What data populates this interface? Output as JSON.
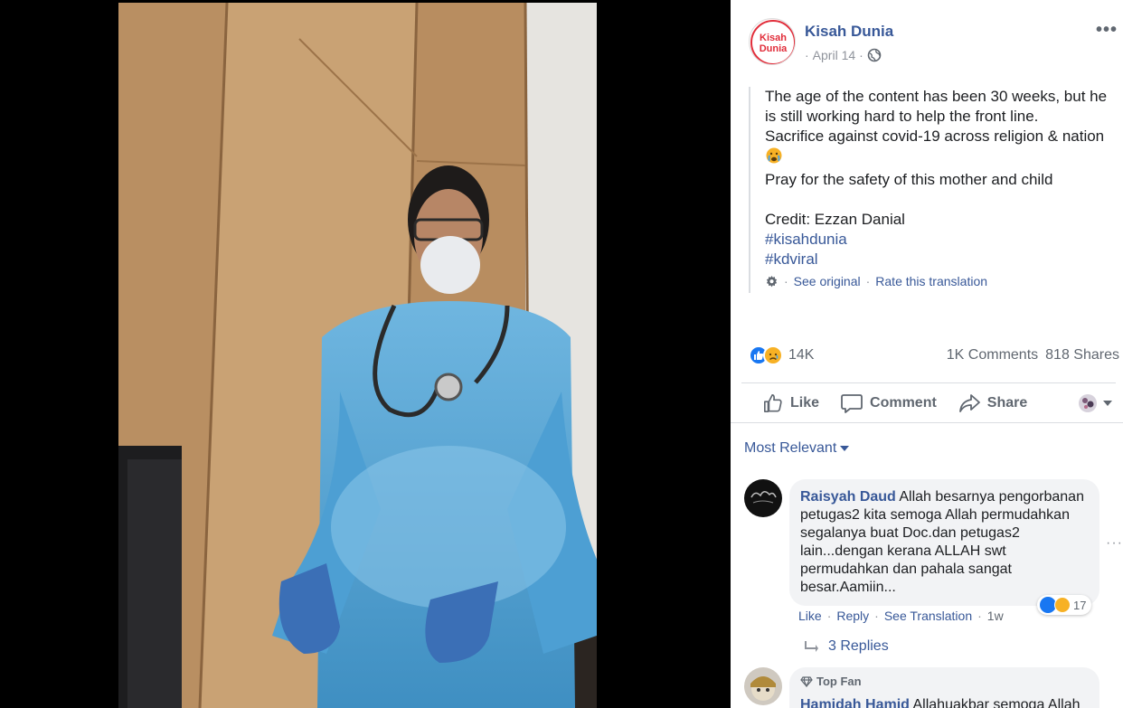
{
  "post": {
    "page_name": "Kisah Dunia",
    "logo_text_1": "Kisah",
    "logo_text_2": "Dunia",
    "date": "April 14",
    "date_separator": "·",
    "more_options": "•••",
    "text_lines": [
      "The age of the content has been 30 weeks, but he",
      "is still working hard to help the front line.",
      "Sacrifice against covid-19 across religion & nation",
      "Pray for the safety of this mother and child",
      "Credit: Ezzan Danial"
    ],
    "hashtags": [
      "#kisahdunia",
      "#kdviral"
    ],
    "see_original": "See original",
    "rate_translation": "Rate this translation",
    "separator": "·",
    "emoji_icon": "crying-face-emoji"
  },
  "reactions": {
    "count": "14K",
    "comments": "1K Comments",
    "shares": "818 Shares",
    "icons": [
      "like-reaction",
      "sad-reaction"
    ]
  },
  "actions": {
    "like": "Like",
    "comment": "Comment",
    "share": "Share"
  },
  "comments": {
    "sort_label": "Most Relevant",
    "items": [
      {
        "author": "Raisyah Daud",
        "lines": [
          "Allah besarnya pengorbanan",
          "petugas2 kita semoga Allah permudahkan",
          "segalanya buat Doc.dan petugas2",
          "lain...dengan kerana ALLAH swt",
          "permudahkan dan pahala sangat",
          "besar.Aamiin..."
        ],
        "reaction_count": "17",
        "like": "Like",
        "reply": "Reply",
        "see_translation": "See Translation",
        "time": "1w",
        "replies": "3 Replies"
      },
      {
        "badge": "Top Fan",
        "author": "Hamidah Hamid",
        "preview": "Allahuakbar semoga Allah"
      }
    ],
    "side_more": "···"
  },
  "colors": {
    "link": "#385898",
    "muted": "#606770",
    "bubble": "#f2f3f5",
    "gown": "#5aa9d6"
  }
}
